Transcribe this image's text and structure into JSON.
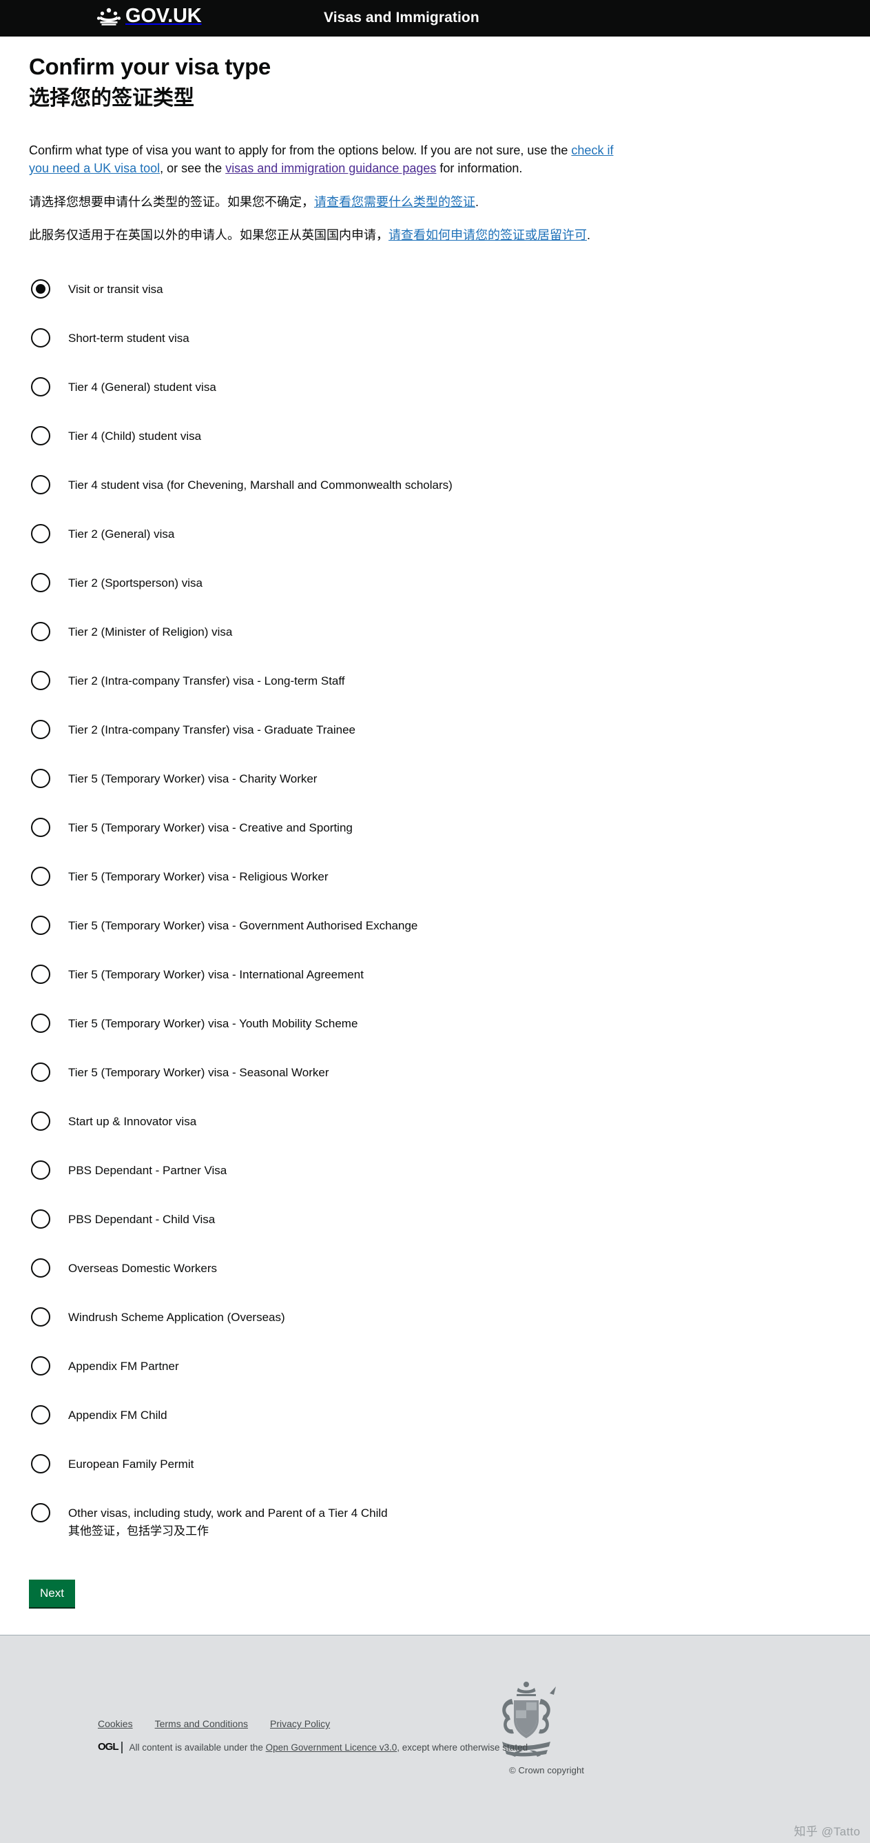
{
  "header": {
    "brand": "GOV.UK",
    "crown_icon": "crown-icon",
    "service_name": "Visas and Immigration",
    "accent_color": "#1d70b8",
    "background_color": "#0b0c0c"
  },
  "main": {
    "title_en": "Confirm your visa type",
    "title_cn": "选择您的签证类型",
    "intro_en": {
      "part1": "Confirm what type of visa you want to apply for from the options below. If you are not sure, use the ",
      "link1": "check if you need a UK visa tool",
      "part2": ", or see the ",
      "link2": "visas and immigration guidance pages",
      "part3": " for information."
    },
    "intro_cn1": {
      "part1": "请选择您想要申请什么类型的签证。如果您不确定，",
      "link1": "请查看您需要什么类型的签证",
      "part2": "."
    },
    "intro_cn2": {
      "part1": "此服务仅适用于在英国以外的申请人。如果您正从英国国内申请，",
      "link1": "请查看如何申请您的签证或居留许可",
      "part2": "."
    },
    "link_color": "#1d70b8",
    "visited_link_color": "#4c2c92"
  },
  "radio_group": {
    "name": "visa-type",
    "selected_index": 0,
    "options": [
      {
        "label": "Visit or transit visa",
        "label_cn": ""
      },
      {
        "label": "Short-term student visa",
        "label_cn": ""
      },
      {
        "label": "Tier 4 (General) student visa",
        "label_cn": ""
      },
      {
        "label": "Tier 4 (Child) student visa",
        "label_cn": ""
      },
      {
        "label": "Tier 4 student visa (for Chevening, Marshall and Commonwealth scholars)",
        "label_cn": ""
      },
      {
        "label": "Tier 2 (General) visa",
        "label_cn": ""
      },
      {
        "label": "Tier 2 (Sportsperson) visa",
        "label_cn": ""
      },
      {
        "label": "Tier 2 (Minister of Religion) visa",
        "label_cn": ""
      },
      {
        "label": "Tier 2 (Intra-company Transfer) visa - Long-term Staff",
        "label_cn": ""
      },
      {
        "label": "Tier 2 (Intra-company Transfer) visa - Graduate Trainee",
        "label_cn": ""
      },
      {
        "label": "Tier 5 (Temporary Worker) visa - Charity Worker",
        "label_cn": ""
      },
      {
        "label": "Tier 5 (Temporary Worker) visa - Creative and Sporting",
        "label_cn": ""
      },
      {
        "label": "Tier 5 (Temporary Worker) visa - Religious Worker",
        "label_cn": ""
      },
      {
        "label": "Tier 5 (Temporary Worker) visa - Government Authorised Exchange",
        "label_cn": ""
      },
      {
        "label": "Tier 5 (Temporary Worker) visa - International Agreement",
        "label_cn": ""
      },
      {
        "label": "Tier 5 (Temporary Worker) visa - Youth Mobility Scheme",
        "label_cn": ""
      },
      {
        "label": "Tier 5 (Temporary Worker) visa - Seasonal Worker",
        "label_cn": ""
      },
      {
        "label": "Start up & Innovator visa",
        "label_cn": ""
      },
      {
        "label": "PBS Dependant - Partner Visa",
        "label_cn": ""
      },
      {
        "label": "PBS Dependant - Child Visa",
        "label_cn": ""
      },
      {
        "label": "Overseas Domestic Workers",
        "label_cn": ""
      },
      {
        "label": "Windrush Scheme Application (Overseas)",
        "label_cn": ""
      },
      {
        "label": "Appendix FM Partner",
        "label_cn": ""
      },
      {
        "label": "Appendix FM Child",
        "label_cn": ""
      },
      {
        "label": "European Family Permit",
        "label_cn": ""
      },
      {
        "label": "Other visas, including study, work and Parent of a Tier 4 Child",
        "label_cn": "其他签证，包括学习及工作"
      }
    ]
  },
  "actions": {
    "next_label": "Next",
    "next_color": "#00703c"
  },
  "footer": {
    "links": [
      {
        "label": "Cookies"
      },
      {
        "label": "Terms and Conditions"
      },
      {
        "label": "Privacy Policy"
      }
    ],
    "ogl_logo": "OGL",
    "licence_prefix": "All content is available under the ",
    "licence_link": "Open Government Licence v3.0",
    "licence_suffix": ", except where otherwise stated",
    "crown_copyright": "© Crown copyright",
    "crest_icon": "royal-coat-of-arms-icon",
    "background_color": "#dee0e2"
  },
  "watermark": "知乎 @Tatto"
}
